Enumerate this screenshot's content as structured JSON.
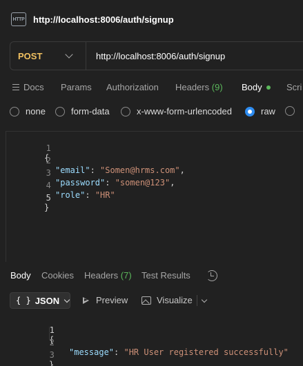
{
  "request": {
    "title": "http://localhost:8006/auth/signup",
    "method": "POST",
    "url": "http://localhost:8006/auth/signup"
  },
  "request_tabs": {
    "docs": "Docs",
    "params": "Params",
    "authorization": "Authorization",
    "headers": "Headers",
    "headers_count": "(9)",
    "body": "Body",
    "scripts": "Scri"
  },
  "body_types": {
    "none": "none",
    "form_data": "form-data",
    "urlencoded": "x-www-form-urlencoded",
    "raw": "raw",
    "selected": "raw"
  },
  "request_body": {
    "line_numbers": [
      "1",
      "2",
      "3",
      "4",
      "5"
    ],
    "open_brace": "{",
    "close_brace": "}",
    "email_key": "\"email\"",
    "email_value": "\"Somen@hrms.com\"",
    "password_key": "\"password\"",
    "password_value": "\"somen@123\"",
    "role_key": "\"role\"",
    "role_value": "\"HR\""
  },
  "response_tabs": {
    "body": "Body",
    "cookies": "Cookies",
    "headers": "Headers",
    "headers_count": "(7)",
    "test_results": "Test Results"
  },
  "response_toolbar": {
    "format_braces": "{ }",
    "format": "JSON",
    "preview": "Preview",
    "visualize": "Visualize"
  },
  "response_body": {
    "line_numbers": [
      "1",
      "2",
      "3"
    ],
    "open_brace": "{",
    "close_brace": "}",
    "message_key": "\"message\"",
    "message_value": "\"HR User registered successfully\""
  },
  "colors": {
    "background": "#212121",
    "method": "#f0c060",
    "accent_green": "#5bb85b",
    "radio_selected": "#2e8cf0",
    "json_key": "#9cdcfe",
    "json_string": "#ce9178"
  }
}
